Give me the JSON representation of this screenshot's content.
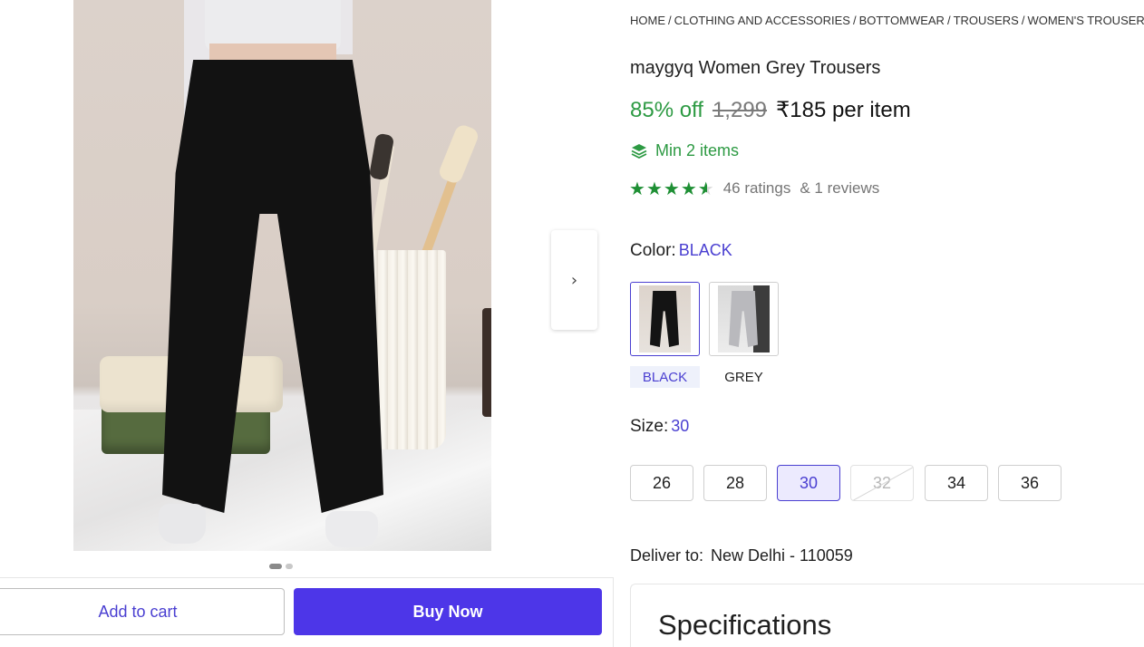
{
  "breadcrumb": [
    "HOME",
    "CLOTHING AND ACCESSORIES",
    "BOTTOMWEAR",
    "TROUSERS",
    "WOMEN'S TROUSERS"
  ],
  "product": {
    "title": "maygyq Women Grey Trousers",
    "discount": "85% off",
    "mrp": "1,299",
    "price": "₹185 per item",
    "min_items": "Min 2 items",
    "rating_value": 4.5,
    "ratings_text": "46 ratings",
    "reviews_text": "& 1 reviews"
  },
  "color": {
    "label": "Color:",
    "selected": "BLACK",
    "options": [
      "BLACK",
      "GREY"
    ]
  },
  "size": {
    "label": "Size:",
    "selected": "30",
    "options": [
      "26",
      "28",
      "30",
      "32",
      "34",
      "36"
    ],
    "unavailable": [
      "32"
    ]
  },
  "delivery": {
    "label": "Deliver to:",
    "location": "New Delhi - 110059"
  },
  "specifications": {
    "title": "Specifications"
  },
  "gallery": {
    "total_images": 2,
    "current_index": 1
  },
  "actions": {
    "add_to_cart": "Add to cart",
    "buy_now": "Buy Now"
  },
  "icons": {
    "next": "chevron-right-icon",
    "min_items": "layers-icon",
    "star": "star-icon"
  },
  "colors": {
    "accent": "#4a3fd1",
    "buy_button": "#4d36e8",
    "discount_green": "#2d9a43",
    "star_green": "#1e8f34"
  }
}
